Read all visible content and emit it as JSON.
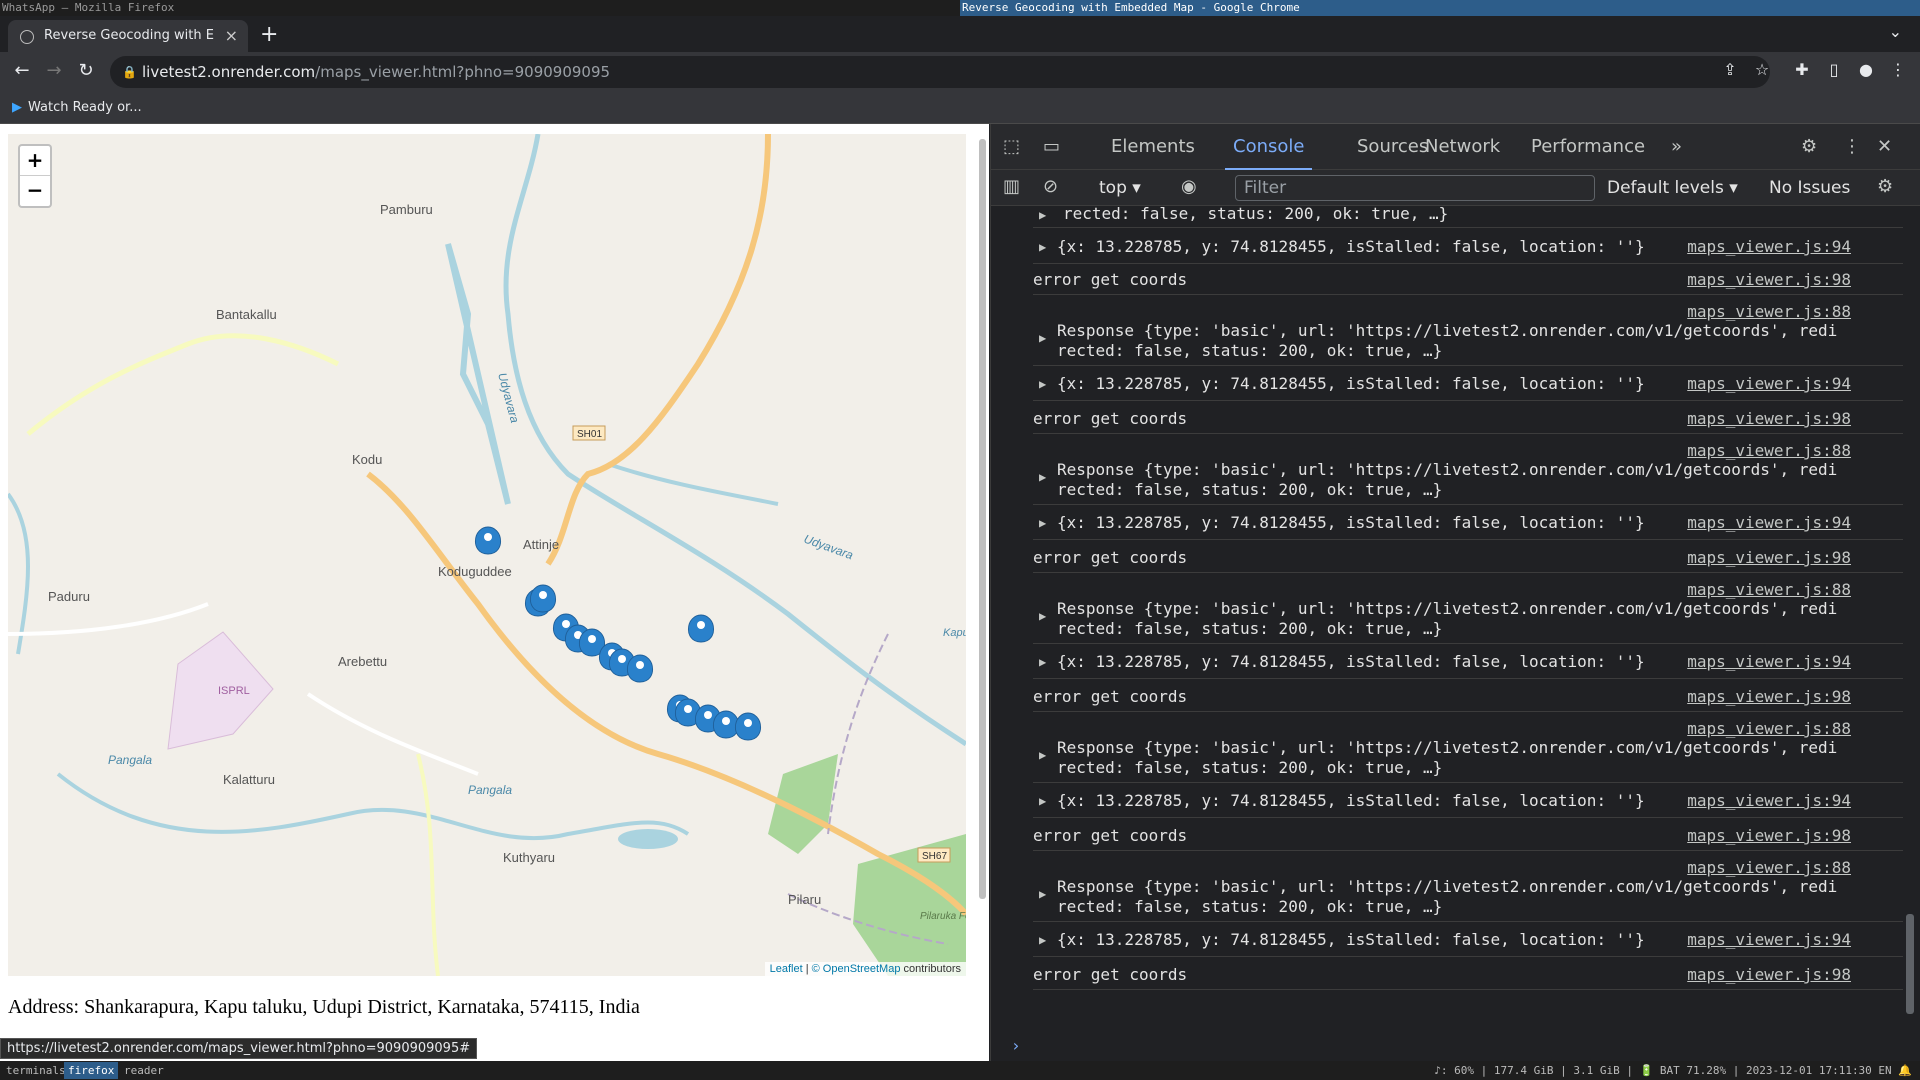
{
  "wm": {
    "left_title": "WhatsApp — Mozilla Firefox",
    "right_title": "Reverse Geocoding with Embedded Map - Google Chrome",
    "workspaces": [
      "terminals",
      "firefox",
      "reader"
    ],
    "status": "♪: 60% | 177.4 GiB | 3.1 GiB | 🔋 BAT 71.28% | 2023-12-01 17:11:30 EN 🔔"
  },
  "browser": {
    "tab_title": "Reverse Geocoding with E",
    "url_host": "livetest2.onrender.com",
    "url_path": "/maps_viewer.html?phno=9090909095",
    "bookmark": "Watch Ready or..."
  },
  "page": {
    "zoom_in": "+",
    "zoom_out": "−",
    "attrib_leaflet": "Leaflet",
    "attrib_osm": "© OpenStreetMap",
    "attrib_tail": "contributors",
    "address": "Address: Shankarapura, Kapu taluku, Udupi District, Karnataka, 574115, India",
    "hover_url": "https://livetest2.onrender.com/maps_viewer.html?phno=9090909095#",
    "map_labels": {
      "pamburu": "Pamburu",
      "bantakallu": "Bantakallu",
      "kodu": "Kodu",
      "attinje": "Attinje",
      "koduguddee": "Koduguddee",
      "paduru": "Paduru",
      "arebettu": "Arebettu",
      "kalatturu": "Kalatturu",
      "pangala1": "Pangala",
      "pangala2": "Pangala",
      "kuthyaru": "Kuthyaru",
      "pilaru": "Pilaru",
      "udyavara": "Udyavara",
      "udyavara2": "Udyavara",
      "isprl": "ISPRL",
      "sh67": "SH67",
      "sh01": "SH01",
      "pilaruk": "Pilaruka Fores",
      "kapu": "Kapu L"
    }
  },
  "devtools": {
    "tabs": [
      "Elements",
      "Console",
      "Sources",
      "Network",
      "Performance"
    ],
    "context": "top",
    "filter_placeholder": "Filter",
    "levels": "Default levels",
    "issues": "No Issues",
    "first_fragment": "rected: false, status: 200, ok: true, …}",
    "first_coords": "{x: 13.228785, y: 74.8128455, isStalled: false, location: ''}",
    "first_src": "maps_viewer.js:94",
    "error_text": "error get coords",
    "error_src": "maps_viewer.js:98",
    "resp_src": "maps_viewer.js:88",
    "resp_line1": "Response {type: 'basic', url: 'https://livetest2.onrender.com/v1/getcoords', redi",
    "resp_line2": "rected: false, status: 200, ok: true, …}",
    "coords_line": "{x: 13.228785, y: 74.8128455, isStalled: false, location: ''}",
    "coords_src": "maps_viewer.js:94"
  },
  "colors": {
    "accent": "#7cacf8",
    "marker": "#2a81cb",
    "road": "#f6c77b"
  }
}
